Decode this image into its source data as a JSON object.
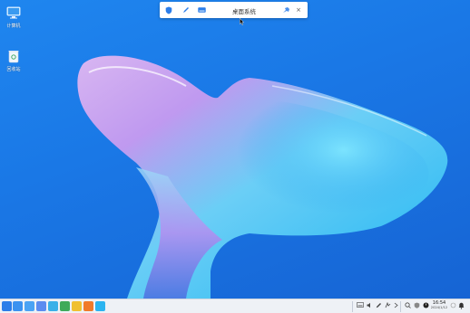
{
  "desktop": {
    "icons": [
      {
        "id": "computer",
        "label": "计算机",
        "icon": "computer-icon"
      },
      {
        "id": "recycle-bin",
        "label": "回收站",
        "icon": "recycle-bin-icon"
      }
    ]
  },
  "remote_toolbar": {
    "title": "桌面系统",
    "close_glyph": "×",
    "buttons": [
      "shield-icon",
      "pen-icon",
      "keyboard-icon",
      "pin-icon"
    ]
  },
  "taskbar": {
    "apps": [
      "start-menu-icon",
      "home-folder-icon",
      "file-manager-icon",
      "photo-viewer-icon",
      "mail-icon",
      "document-editor-icon",
      "image-editor-icon",
      "office-suite-icon",
      "browser-icon"
    ],
    "tray": [
      "keyboard-icon",
      "volume-icon",
      "pen-icon",
      "network-icon",
      "chevron-right-icon",
      "search-icon",
      "security-icon",
      "power-icon"
    ],
    "clock": {
      "time": "16:54",
      "date": "2024/1/12"
    },
    "notification_icon": "bell-icon"
  },
  "colors": {
    "desktop_bg": "#1a78e6",
    "taskbar_bg": "#eef1f6",
    "accent": "#2b7de9"
  }
}
